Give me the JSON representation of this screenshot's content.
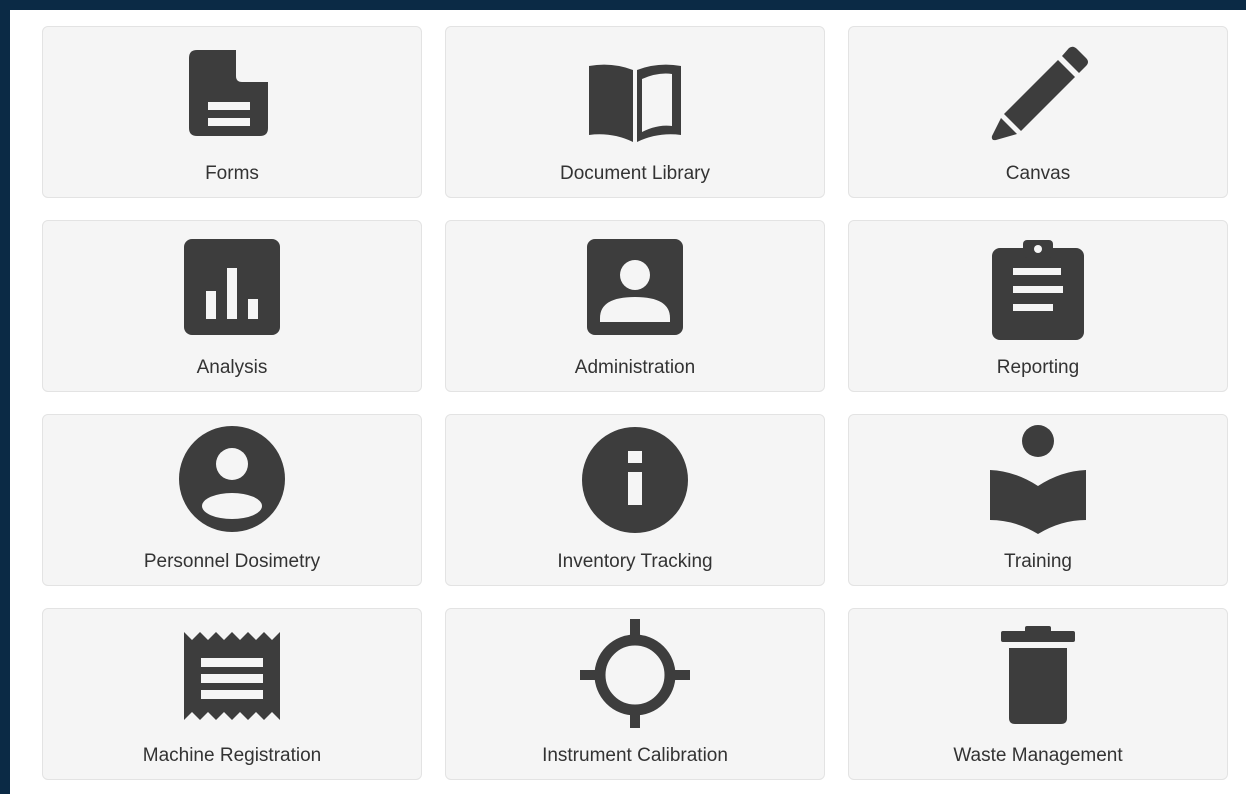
{
  "colors": {
    "frame": "#0b2a45",
    "tile_bg": "#f5f5f5",
    "icon": "#3d3d3d",
    "text": "#333333"
  },
  "tiles": [
    {
      "label": "Forms",
      "icon": "file-text-icon"
    },
    {
      "label": "Document Library",
      "icon": "open-book-icon"
    },
    {
      "label": "Canvas",
      "icon": "pencil-icon"
    },
    {
      "label": "Analysis",
      "icon": "bar-chart-icon"
    },
    {
      "label": "Administration",
      "icon": "account-box-icon"
    },
    {
      "label": "Reporting",
      "icon": "clipboard-icon"
    },
    {
      "label": "Personnel Dosimetry",
      "icon": "user-circle-icon"
    },
    {
      "label": "Inventory Tracking",
      "icon": "info-circle-icon"
    },
    {
      "label": "Training",
      "icon": "reader-icon"
    },
    {
      "label": "Machine Registration",
      "icon": "receipt-icon"
    },
    {
      "label": "Instrument Calibration",
      "icon": "crosshair-icon"
    },
    {
      "label": "Waste Management",
      "icon": "trash-icon"
    }
  ]
}
